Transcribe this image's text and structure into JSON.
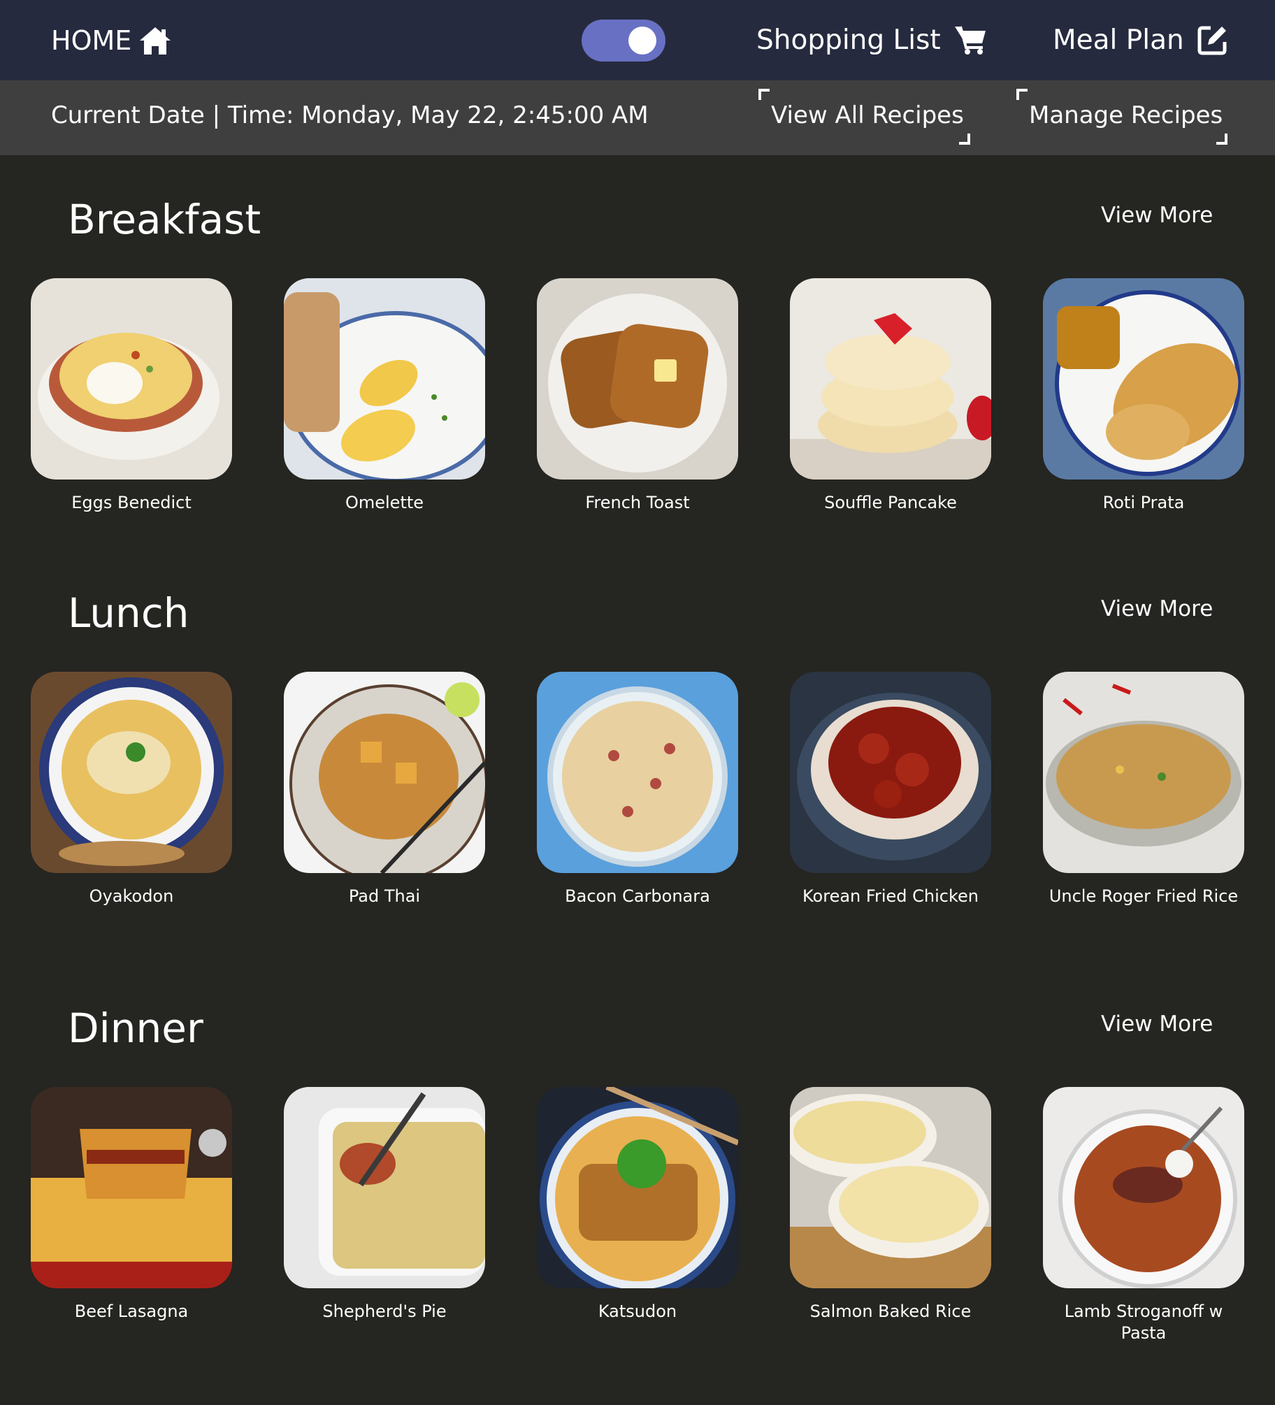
{
  "header": {
    "home_label": "HOME",
    "shopping_list_label": "Shopping List",
    "meal_plan_label": "Meal Plan",
    "toggle_on": true
  },
  "subbar": {
    "datetime": "Current Date | Time: Monday, May 22, 2:45:00 AM",
    "view_all_label": "View All Recipes",
    "manage_label": "Manage Recipes"
  },
  "colors": {
    "topbar": "#262a3e",
    "subbar": "#3f3f3f",
    "page": "#252521",
    "toggle": "#6870c4"
  },
  "sections": [
    {
      "title": "Breakfast",
      "view_more": "View More",
      "recipes": [
        {
          "name": "Eggs Benedict"
        },
        {
          "name": "Omelette"
        },
        {
          "name": "French Toast"
        },
        {
          "name": "Souffle Pancake"
        },
        {
          "name": "Roti Prata"
        }
      ]
    },
    {
      "title": "Lunch",
      "view_more": "View More",
      "recipes": [
        {
          "name": "Oyakodon"
        },
        {
          "name": "Pad Thai"
        },
        {
          "name": "Bacon Carbonara"
        },
        {
          "name": "Korean Fried Chicken"
        },
        {
          "name": "Uncle Roger Fried Rice"
        }
      ]
    },
    {
      "title": "Dinner",
      "view_more": "View More",
      "recipes": [
        {
          "name": "Beef Lasagna"
        },
        {
          "name": "Shepherd's Pie"
        },
        {
          "name": "Katsudon"
        },
        {
          "name": "Salmon Baked Rice"
        },
        {
          "name": "Lamb Stroganoff w Pasta"
        }
      ]
    }
  ]
}
